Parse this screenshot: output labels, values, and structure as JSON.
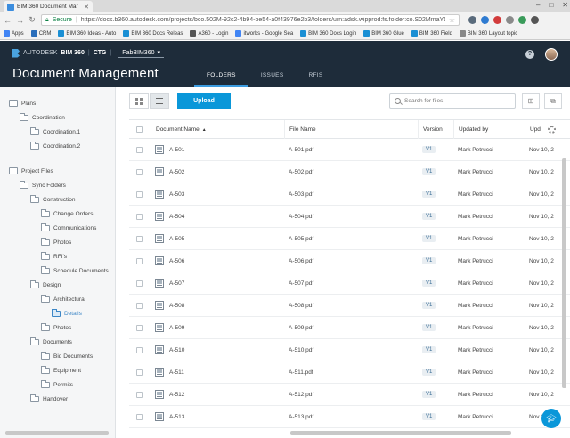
{
  "browser": {
    "tab_title": "BIM 360 Document Mar",
    "secure_label": "Secure",
    "url": "https://docs.b360.autodesk.com/projects/bco.502M-92c2-4b94-be54-a0f43976e2b3/folders/urn:adsk.wipprod:fs.folder:co.S02MmaYSRCOlc...",
    "bookmarks": [
      {
        "label": "Apps",
        "color": "#4285f4"
      },
      {
        "label": "CRM",
        "color": "#2a6ebb"
      },
      {
        "label": "BIM 360 Ideas - Auto",
        "color": "#1a8fd4"
      },
      {
        "label": "BIM 360 Docs Releas",
        "color": "#1a8fd4"
      },
      {
        "label": "A360 - Login",
        "color": "#555555"
      },
      {
        "label": "itworks - Google Sea",
        "color": "#4285f4"
      },
      {
        "label": "BIM 360 Docs Login",
        "color": "#1a8fd4"
      },
      {
        "label": "BIM 360 Glue",
        "color": "#1a8fd4"
      },
      {
        "label": "BIM 360 Field",
        "color": "#1a8fd4"
      },
      {
        "label": "BIM 360 Layout topic",
        "color": "#888888"
      }
    ]
  },
  "header": {
    "brand_prefix": "AUTODESK",
    "brand_product": "BIM 360",
    "brand_sep": "|",
    "account": "CTG",
    "project": "FabBIM360",
    "page_title": "Document Management",
    "tabs": [
      {
        "label": "FOLDERS",
        "active": true
      },
      {
        "label": "ISSUES",
        "active": false
      },
      {
        "label": "RFIS",
        "active": false
      }
    ],
    "help_glyph": "?"
  },
  "sidebar": {
    "items": [
      {
        "label": "Plans",
        "level": 0,
        "kind": "section"
      },
      {
        "label": "Coordination",
        "level": 1,
        "kind": "folder"
      },
      {
        "label": "Coordination.1",
        "level": 2,
        "kind": "folder"
      },
      {
        "label": "Coordination.2",
        "level": 2,
        "kind": "folder"
      },
      {
        "label": "Project Files",
        "level": 0,
        "kind": "section"
      },
      {
        "label": "Sync Folders",
        "level": 1,
        "kind": "folder"
      },
      {
        "label": "Construction",
        "level": 2,
        "kind": "folder"
      },
      {
        "label": "Change Orders",
        "level": 3,
        "kind": "folder"
      },
      {
        "label": "Communications",
        "level": 3,
        "kind": "folder"
      },
      {
        "label": "Photos",
        "level": 3,
        "kind": "folder"
      },
      {
        "label": "RFI's",
        "level": 3,
        "kind": "folder"
      },
      {
        "label": "Schedule Documents",
        "level": 3,
        "kind": "folder"
      },
      {
        "label": "Design",
        "level": 2,
        "kind": "folder"
      },
      {
        "label": "Architectural",
        "level": 3,
        "kind": "folder"
      },
      {
        "label": "Details",
        "level": 4,
        "kind": "folder",
        "selected": true
      },
      {
        "label": "Photos",
        "level": 3,
        "kind": "folder"
      },
      {
        "label": "Documents",
        "level": 2,
        "kind": "folder"
      },
      {
        "label": "Bid Documents",
        "level": 3,
        "kind": "folder"
      },
      {
        "label": "Equipment",
        "level": 3,
        "kind": "folder"
      },
      {
        "label": "Permits",
        "level": 3,
        "kind": "folder"
      },
      {
        "label": "Handover",
        "level": 2,
        "kind": "folder"
      }
    ]
  },
  "toolbar": {
    "upload_label": "Upload",
    "search_placeholder": "Search for files"
  },
  "table": {
    "columns": [
      "Document Name",
      "File Name",
      "Version",
      "Updated by",
      "Upd"
    ],
    "rows": [
      {
        "name": "A-501",
        "file": "A-501.pdf",
        "version": "V1",
        "updated_by": "Mark Petrucci",
        "updated": "Nov 10, 2"
      },
      {
        "name": "A-502",
        "file": "A-502.pdf",
        "version": "V1",
        "updated_by": "Mark Petrucci",
        "updated": "Nov 10, 2"
      },
      {
        "name": "A-503",
        "file": "A-503.pdf",
        "version": "V1",
        "updated_by": "Mark Petrucci",
        "updated": "Nov 10, 2"
      },
      {
        "name": "A-504",
        "file": "A-504.pdf",
        "version": "V1",
        "updated_by": "Mark Petrucci",
        "updated": "Nov 10, 2"
      },
      {
        "name": "A-505",
        "file": "A-505.pdf",
        "version": "V1",
        "updated_by": "Mark Petrucci",
        "updated": "Nov 10, 2"
      },
      {
        "name": "A-506",
        "file": "A-506.pdf",
        "version": "V1",
        "updated_by": "Mark Petrucci",
        "updated": "Nov 10, 2"
      },
      {
        "name": "A-507",
        "file": "A-507.pdf",
        "version": "V1",
        "updated_by": "Mark Petrucci",
        "updated": "Nov 10, 2"
      },
      {
        "name": "A-508",
        "file": "A-508.pdf",
        "version": "V1",
        "updated_by": "Mark Petrucci",
        "updated": "Nov 10, 2"
      },
      {
        "name": "A-509",
        "file": "A-509.pdf",
        "version": "V1",
        "updated_by": "Mark Petrucci",
        "updated": "Nov 10, 2"
      },
      {
        "name": "A-510",
        "file": "A-510.pdf",
        "version": "V1",
        "updated_by": "Mark Petrucci",
        "updated": "Nov 10, 2"
      },
      {
        "name": "A-511",
        "file": "A-511.pdf",
        "version": "V1",
        "updated_by": "Mark Petrucci",
        "updated": "Nov 10, 2"
      },
      {
        "name": "A-512",
        "file": "A-512.pdf",
        "version": "V1",
        "updated_by": "Mark Petrucci",
        "updated": "Nov 10, 2"
      },
      {
        "name": "A-513",
        "file": "A-513.pdf",
        "version": "V1",
        "updated_by": "Mark Petrucci",
        "updated": "Nov 10, 2"
      }
    ]
  },
  "colors": {
    "header_bg": "#1e2c3a",
    "accent": "#0a97d9",
    "selected_folder": "#3c86c6"
  }
}
